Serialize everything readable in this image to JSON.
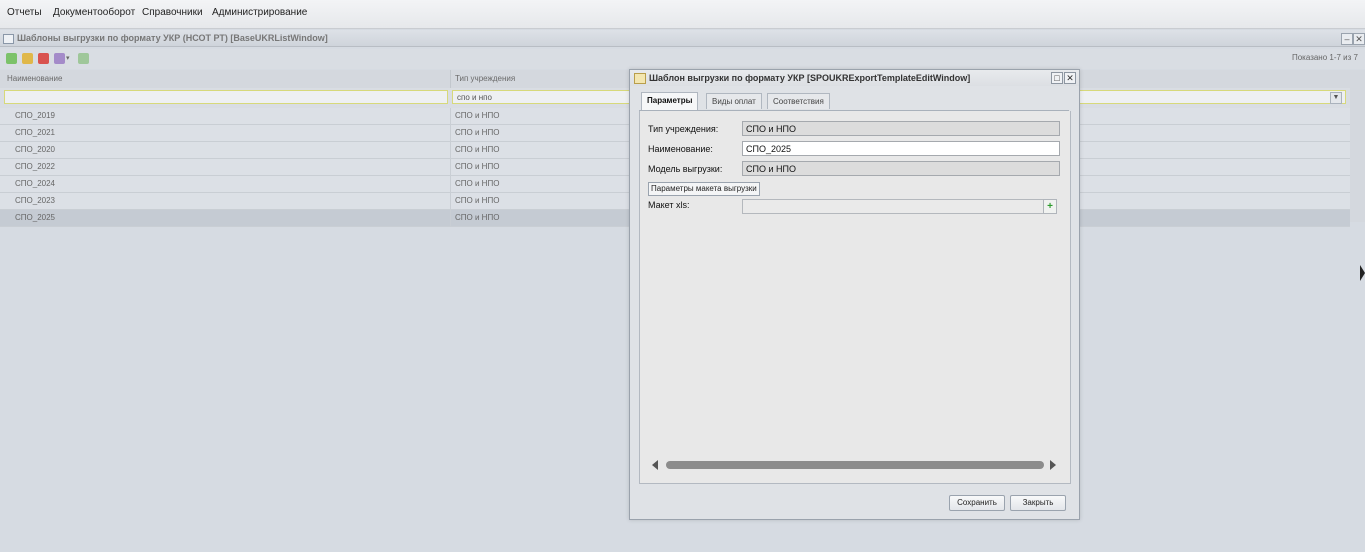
{
  "menu": [
    "Отчеты",
    "Документооборот",
    "Справочники",
    "Администрирование"
  ],
  "list_window": {
    "title": "Шаблоны выгрузки по формату УКР (НСОТ РТ) [BaseUKRListWindow]",
    "pager_info": "Показано 1-7 из 7",
    "columns": [
      "Наименование",
      "Тип учреждения"
    ],
    "filter_name": "",
    "filter_type": "спо и нпо",
    "rows": [
      {
        "name": "СПО_2019",
        "type": "СПО и НПО"
      },
      {
        "name": "СПО_2021",
        "type": "СПО и НПО"
      },
      {
        "name": "СПО_2020",
        "type": "СПО и НПО"
      },
      {
        "name": "СПО_2022",
        "type": "СПО и НПО"
      },
      {
        "name": "СПО_2024",
        "type": "СПО и НПО"
      },
      {
        "name": "СПО_2023",
        "type": "СПО и НПО"
      },
      {
        "name": "СПО_2025",
        "type": "СПО и НПО"
      }
    ]
  },
  "dialog": {
    "title": "Шаблон выгрузки по формату УКР [SPOUKRExportTemplateEditWindow]",
    "tabs": [
      "Параметры",
      "Виды оплат",
      "Соответствия"
    ],
    "fields": {
      "type_label": "Тип учреждения:",
      "type_value": "СПО и НПО",
      "name_label": "Наименование:",
      "name_value": "СПО_2025",
      "model_label": "Модель выгрузки:",
      "model_value": "СПО и НПО",
      "params_button": "Параметры макета выгрузки",
      "xls_label": "Макет xls:"
    },
    "buttons": {
      "save": "Сохранить",
      "close": "Закрыть"
    }
  }
}
